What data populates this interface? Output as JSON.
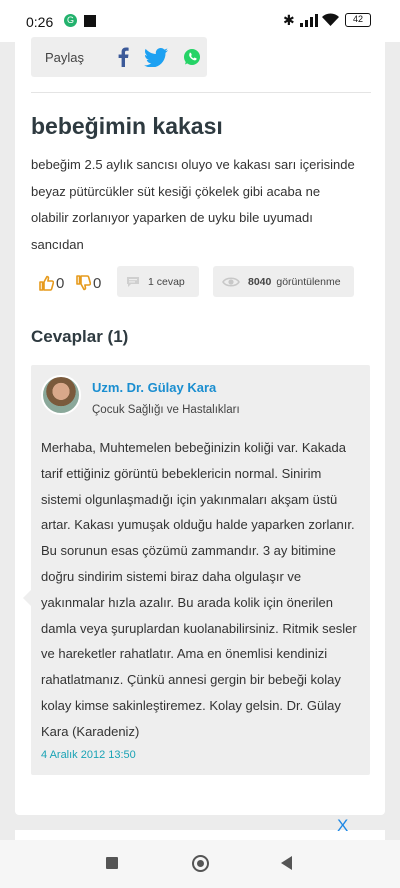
{
  "status_bar": {
    "time": "0:26",
    "notification_glyph": "G",
    "battery": "42"
  },
  "share": {
    "label": "Paylaş",
    "colors": {
      "facebook": "#3b5998",
      "twitter": "#1da1f2",
      "whatsapp": "#25d366"
    }
  },
  "question": {
    "title": "bebeğimin kakası",
    "body": "bebeğim 2.5 aylık sancısı oluyo ve kakası sarı içerisinde beyaz pütürcükler süt kesiği çökelek gibi acaba ne olabilir zorlanıyor yaparken de uyku bile uyumadı sancıdan",
    "likes": "0",
    "dislikes": "0",
    "answers_chip": "1 cevap",
    "views_count": "8040",
    "views_label": "görüntülenme"
  },
  "answers": {
    "heading": "Cevaplar (1)",
    "items": [
      {
        "author": "Uzm. Dr. Gülay Kara",
        "specialty": "Çocuk Sağlığı ve Hastalıkları",
        "text": "Merhaba, Muhtemelen bebeğinizin koliği var. Kakada tarif ettiğiniz görüntü bebeklericin normal. Sinirim sistemi olgunlaşmadığı için yakınmaları akşam üstü artar. Kakası yumuşak olduğu halde yaparken zorlanır. Bu sorunun esas çözümü zammandır. 3 ay bitimine doğru sindirim sistemi biraz daha olgulaşır ve yakınmalar hızla azalır. Bu arada kolik için önerilen damla veya şuruplardan kuolanabilirsiniz. Ritmik sesler ve hareketler rahatlatır. Ama en önemlisi kendinizi rahatlatmanız. Çünkü annesi gergin bir bebeği kolay kolay kimse sakinleştiremez. Kolay gelsin. Dr. Gülay Kara (Karadeniz)",
        "date": "4 Aralık 2012 13:50"
      }
    ]
  },
  "ad": {
    "close_label": "X"
  },
  "theme": {
    "link_blue": "#1a8ed0",
    "accent_orange": "#e69a1c",
    "date_teal": "#1aa3b5"
  }
}
